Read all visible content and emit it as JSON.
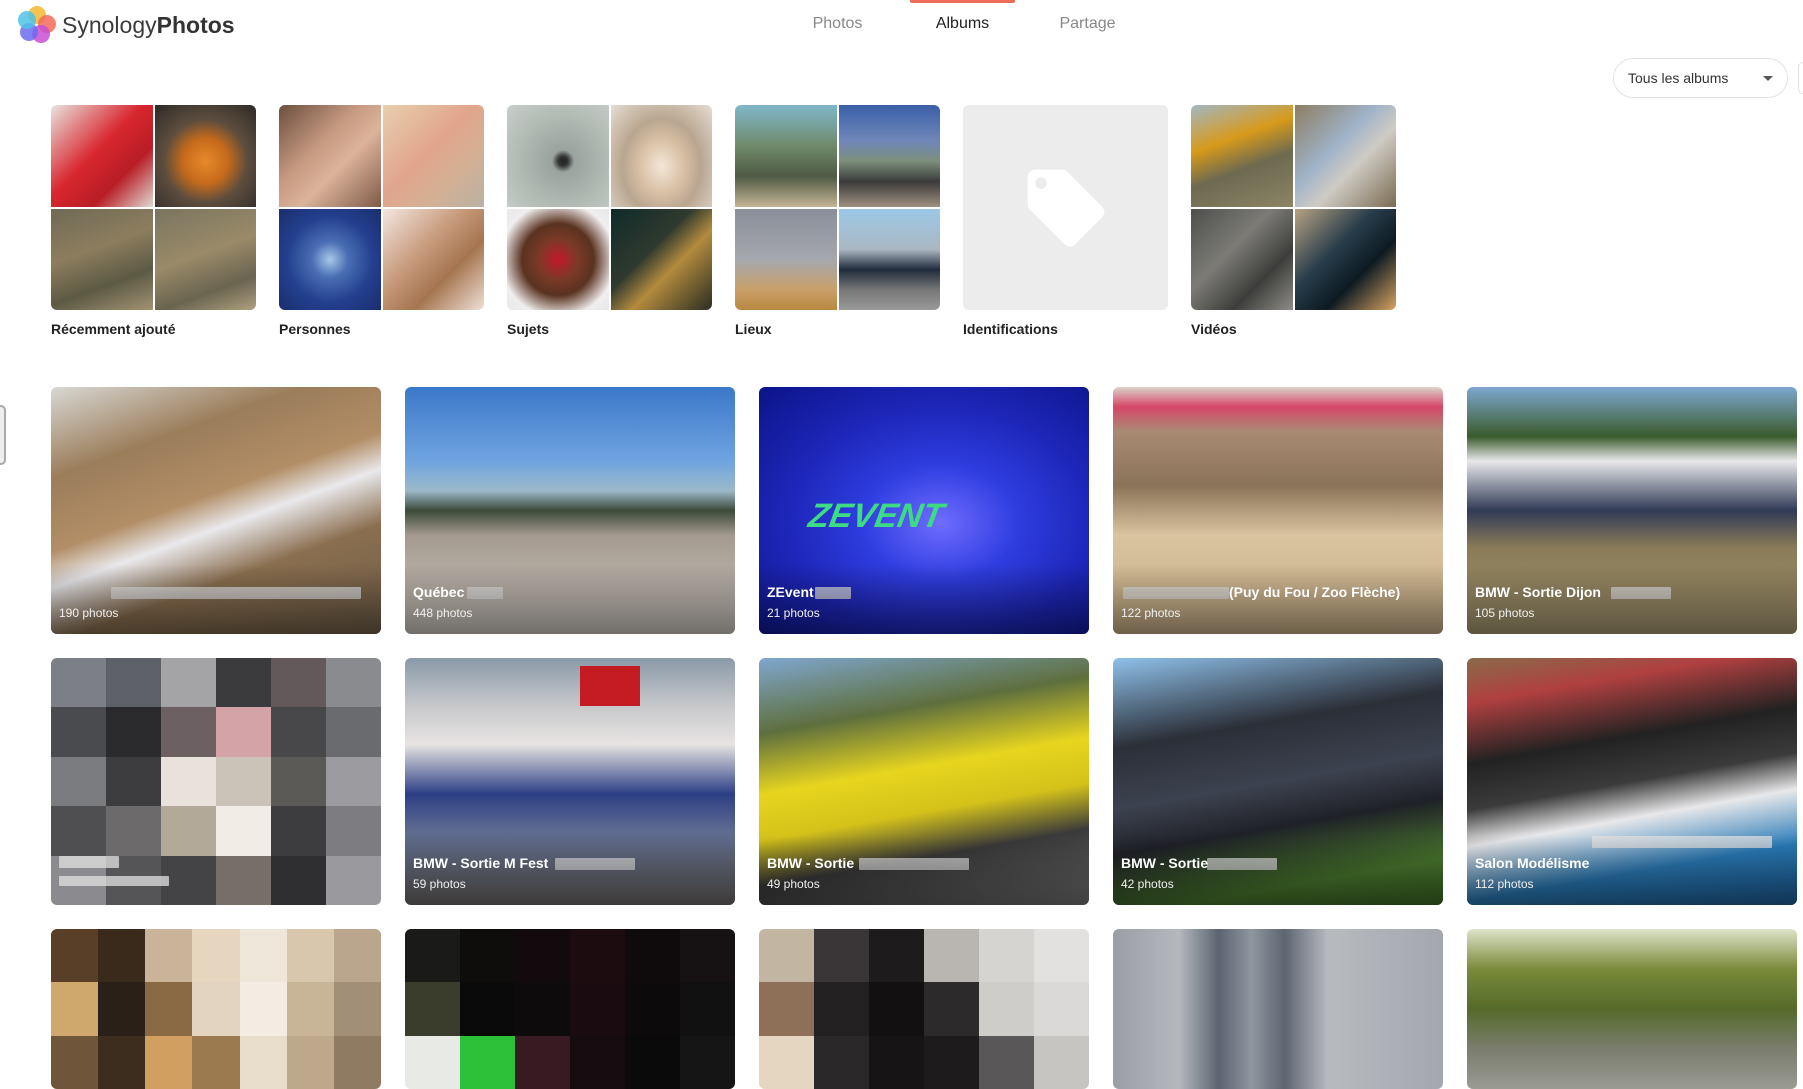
{
  "app": {
    "brand_light": "Synology",
    "brand_bold": "Photos"
  },
  "tabs": [
    {
      "label": "Photos",
      "active": false
    },
    {
      "label": "Albums",
      "active": true
    },
    {
      "label": "Partage",
      "active": false
    }
  ],
  "filter": {
    "label": "Tous les albums"
  },
  "smart_albums": [
    {
      "label": "Récemment ajouté"
    },
    {
      "label": "Personnes"
    },
    {
      "label": "Sujets"
    },
    {
      "label": "Lieux"
    },
    {
      "label": "Identifications"
    },
    {
      "label": "Vidéos"
    }
  ],
  "albums": [
    {
      "title": "",
      "count": "190 photos"
    },
    {
      "title": "Québec",
      "count": "448 photos"
    },
    {
      "title": "ZEvent",
      "count": "21 photos"
    },
    {
      "title": "(Puy du Fou / Zoo Flèche)",
      "count": "122 photos"
    },
    {
      "title": "BMW - Sortie Dijon",
      "count": "105 photos"
    },
    {
      "title": "",
      "count": ""
    },
    {
      "title": "BMW - Sortie M Fest",
      "count": "59 photos"
    },
    {
      "title": "BMW - Sortie",
      "count": "49 photos"
    },
    {
      "title": "BMW - Sortie",
      "count": "42 photos"
    },
    {
      "title": "Salon Modélisme",
      "count": "112 photos"
    },
    {
      "title": "",
      "count": ""
    },
    {
      "title": "",
      "count": ""
    },
    {
      "title": "",
      "count": ""
    },
    {
      "title": "",
      "count": ""
    },
    {
      "title": "",
      "count": ""
    }
  ],
  "accent_color": "#ef6c5a"
}
